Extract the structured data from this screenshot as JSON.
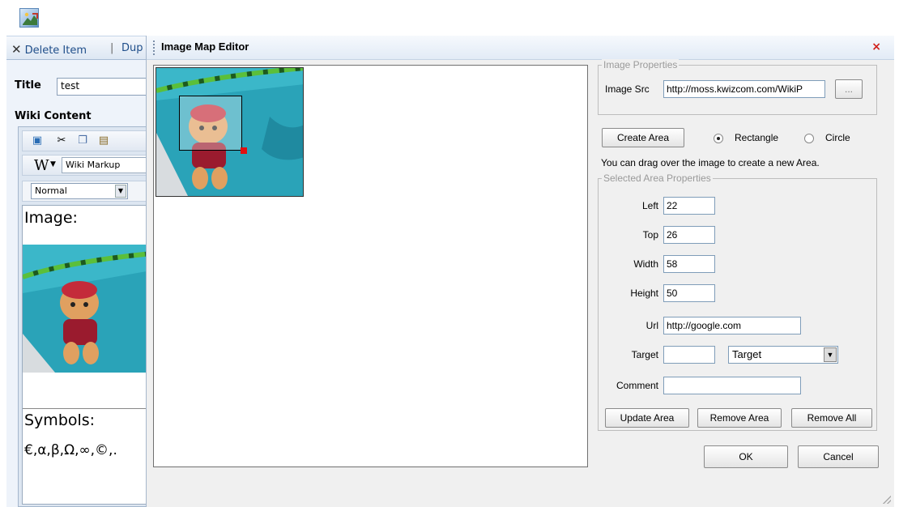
{
  "page": {
    "toolbar": {
      "delete_label": "Delete Item",
      "separator": "|",
      "duplicate_label": "Dup"
    },
    "title_label": "Title",
    "title_value": "test",
    "wiki_content_label": "Wiki Content",
    "editor": {
      "wiki_markup_label": "Wiki Markup",
      "style_select_value": "Normal",
      "doc": {
        "image_heading": "Image:",
        "symbols_heading": "Symbols:",
        "symbols_text": "€,α,β,Ω,∞,©,."
      }
    }
  },
  "dialog": {
    "title": "Image Map Editor",
    "close_glyph": "×",
    "image_properties": {
      "legend": "Image Properties",
      "src_label": "Image Src",
      "src_value": "http://moss.kwizcom.com/WikiP",
      "browse_label": "..."
    },
    "create_area_label": "Create Area",
    "shape_options": [
      {
        "label": "Rectangle",
        "selected": true
      },
      {
        "label": "Circle",
        "selected": false
      }
    ],
    "hint": "You can drag over the image to create a new Area.",
    "selected_area": {
      "legend": "Selected Area Properties",
      "left_label": "Left",
      "left_value": "22",
      "top_label": "Top",
      "top_value": "26",
      "width_label": "Width",
      "width_value": "58",
      "height_label": "Height",
      "height_value": "50",
      "url_label": "Url",
      "url_value": "http://google.com",
      "target_label": "Target",
      "target_value": "",
      "target_select_value": "Target",
      "comment_label": "Comment",
      "comment_value": ""
    },
    "buttons": {
      "update_area": "Update Area",
      "remove_area": "Remove Area",
      "remove_all": "Remove All",
      "ok": "OK",
      "cancel": "Cancel"
    }
  },
  "icons": {
    "app": "image-map-icon",
    "delete": "delete-x-icon",
    "close": "close-icon",
    "dropdown": "chevron-down-icon"
  },
  "colors": {
    "toolbar_link": "#1f4e8a",
    "close_red": "#d0201a",
    "area_handle": "#e01010",
    "pool_water": "#2aa3b8"
  }
}
